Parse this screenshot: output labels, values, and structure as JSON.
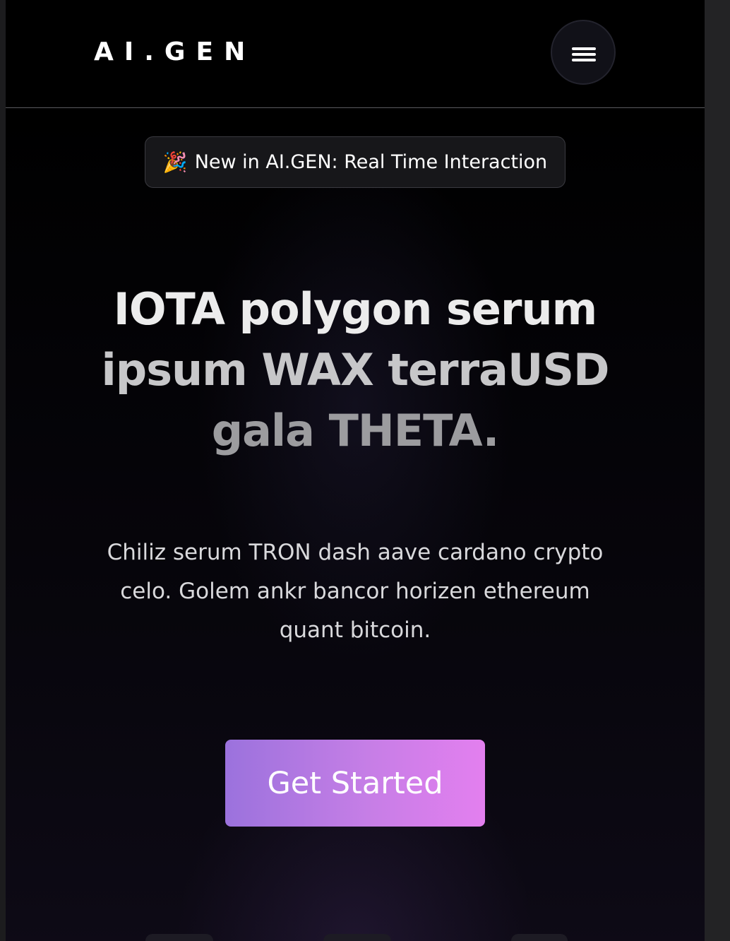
{
  "navbar": {
    "logo": "AI.GEN",
    "menu_icon": "hamburger-menu-icon"
  },
  "announcement": {
    "emoji": "🎉",
    "text": "New in AI.GEN: Real Time Interaction"
  },
  "hero": {
    "title_lines": [
      "IOTA polygon serum",
      "ipsum WAX terraUSD",
      "gala THETA."
    ],
    "subtitle": "Chiliz serum TRON dash aave cardano crypto celo. Golem ankr bancor horizen ethereum quant bitcoin.",
    "cta_label": "Get Started"
  },
  "colors": {
    "background": "#000000",
    "cta_gradient_start": "#9b72dd",
    "cta_gradient_end": "#e37fef",
    "announcement_bg": "#17171a"
  }
}
